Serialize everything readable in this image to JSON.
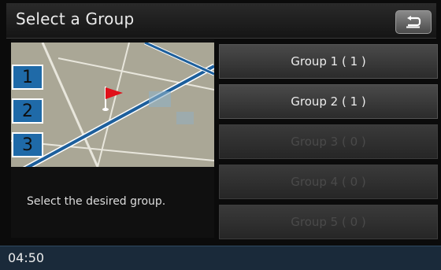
{
  "header": {
    "title": "Select a Group"
  },
  "back_button": {
    "icon": "back-arrow-icon"
  },
  "map": {
    "markers": [
      "1",
      "2",
      "3"
    ],
    "flag_icon": "red-flag-icon"
  },
  "hint": {
    "text": "Select the desired group."
  },
  "groups": [
    {
      "label": "Group 1 ( 1 )",
      "enabled": true
    },
    {
      "label": "Group 2 ( 1 )",
      "enabled": true
    },
    {
      "label": "Group 3 ( 0 )",
      "enabled": false
    },
    {
      "label": "Group 4 ( 0 )",
      "enabled": false
    },
    {
      "label": "Group 5 ( 0 )",
      "enabled": false
    }
  ],
  "status": {
    "time": "04:50"
  },
  "colors": {
    "marker_blue": "#1f6aa8",
    "flag_red": "#e0101a",
    "road_blue": "#1d5f9c"
  }
}
